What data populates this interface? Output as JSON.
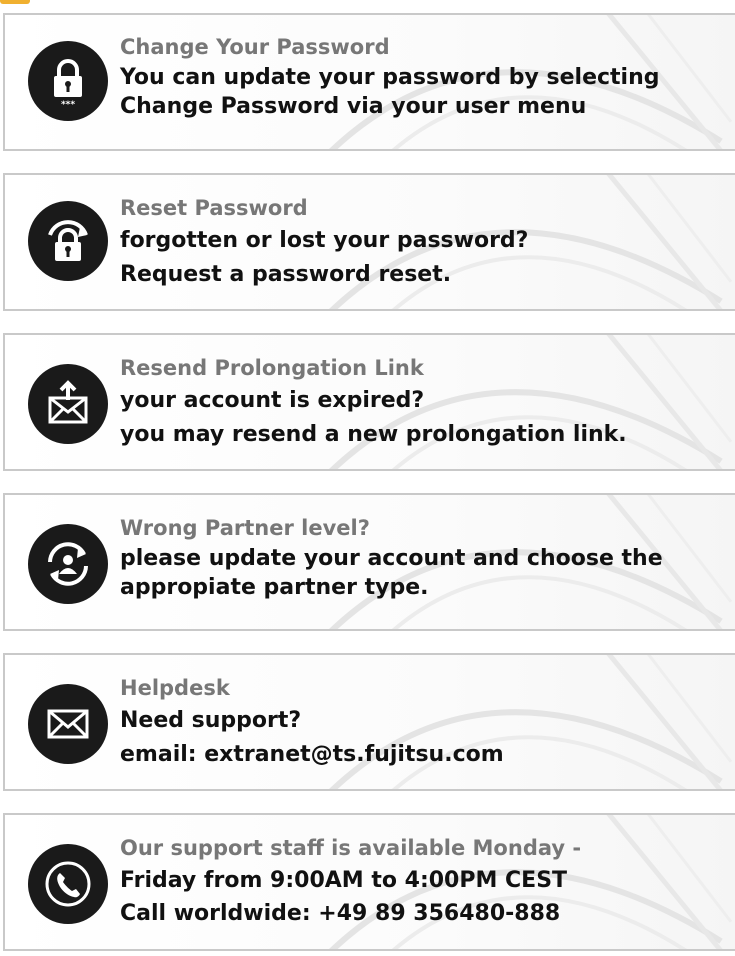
{
  "cards": [
    {
      "id": "change-password",
      "icon": "lock-password-icon",
      "title": "Change Your Password",
      "lines": [
        "You can update your password by selecting",
        "Change Password via your user menu"
      ]
    },
    {
      "id": "reset-password",
      "icon": "lock-reset-icon",
      "title": "Reset Password",
      "lines": [
        "forgotten or lost your password?",
        "Request a password reset."
      ]
    },
    {
      "id": "resend-prolongation",
      "icon": "mail-upload-icon",
      "title": "Resend Prolongation Link",
      "lines": [
        "your account is expired?",
        "you may resend a new prolongation link."
      ]
    },
    {
      "id": "wrong-partner",
      "icon": "user-sync-icon",
      "title": "Wrong Partner level?",
      "lines": [
        "please update your account and choose the",
        "appropiate partner type."
      ]
    },
    {
      "id": "helpdesk",
      "icon": "envelope-icon",
      "title": "Helpdesk",
      "lines": [
        "Need support?",
        "email: extranet@ts.fujitsu.com"
      ]
    },
    {
      "id": "support-hours",
      "icon": "phone-icon",
      "title": "Our support staff is available Monday -",
      "lines": [
        "Friday from 9:00AM to 4:00PM CEST",
        "Call worldwide: +49 89 356480-888"
      ]
    }
  ]
}
